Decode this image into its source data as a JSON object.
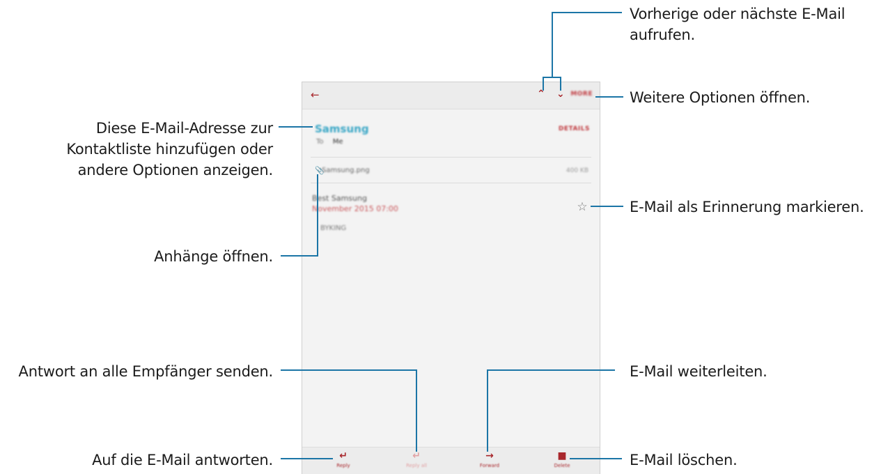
{
  "annotations": {
    "prev_next_line1": "Vorherige oder nächste E-Mail",
    "prev_next_line2": "aufrufen.",
    "more_options": "Weitere Optionen öffnen.",
    "contact_line1": "Diese E-Mail-Adresse zur",
    "contact_line2": "Kontaktliste hinzufügen oder",
    "contact_line3": "andere Optionen anzeigen.",
    "reminder": "E-Mail als Erinnerung markieren.",
    "attachments": "Anhänge öffnen.",
    "reply_all": "Antwort an alle Empfänger senden.",
    "forward": "E-Mail weiterleiten.",
    "reply": "Auf die E-Mail antworten.",
    "delete": "E-Mail löschen."
  },
  "app": {
    "appbar": {
      "back_icon": "arrow-left",
      "prev_icon": "chevron-up",
      "next_icon": "chevron-down",
      "more_label": "MORE"
    },
    "header": {
      "sender": "Samsung",
      "details_label": "DETAILS",
      "to_label": "To",
      "to_name": "Me"
    },
    "attachment": {
      "file_name": "Samsung.png",
      "file_size": "400 KB"
    },
    "message": {
      "line1": "Best Samsung",
      "line2": "November 2015 07:00",
      "body": "BYKING"
    },
    "bottom_bar": {
      "reply": "Reply",
      "reply_all": "Reply all",
      "forward": "Forward",
      "delete": "Delete"
    }
  },
  "colors": {
    "accent": "#a8272c",
    "sender": "#3ba7c6",
    "callout_line": "#1b75a6"
  }
}
